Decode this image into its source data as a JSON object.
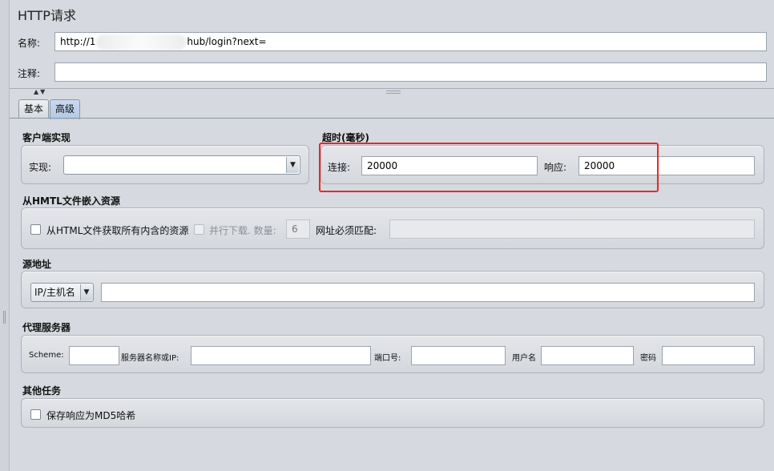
{
  "panel_title": "HTTP请求",
  "name_label": "名称:",
  "name_value_prefix": "http://1",
  "name_value_suffix": "hub/login?next=",
  "comment_label": "注释:",
  "comment_value": "",
  "tabs": [
    {
      "label": "基本",
      "active": false
    },
    {
      "label": "高级",
      "active": true
    }
  ],
  "client_impl": {
    "title": "客户端实现",
    "impl_label": "实现:",
    "impl_value": ""
  },
  "timeout": {
    "title": "超时(毫秒)",
    "connect_label": "连接:",
    "connect_value": "20000",
    "response_label": "响应:",
    "response_value": "20000"
  },
  "embedded": {
    "title": "从HMTL文件嵌入资源",
    "retrieve_label": "从HTML文件获取所有内含的资源",
    "retrieve_checked": false,
    "parallel_label": "并行下载. 数量:",
    "parallel_checked": false,
    "parallel_count": "6",
    "url_match_label": "网址必须匹配:",
    "url_match_value": ""
  },
  "source": {
    "title": "源地址",
    "type_value": "IP/主机名",
    "address_value": ""
  },
  "proxy": {
    "title": "代理服务器",
    "scheme_label": "Scheme:",
    "scheme_value": "",
    "server_label": "服务器名称或IP:",
    "server_value": "",
    "port_label": "端口号:",
    "port_value": "",
    "user_label": "用户名",
    "user_value": "",
    "password_label": "密码",
    "password_value": ""
  },
  "other": {
    "title": "其他任务",
    "md5_label": "保存响应为MD5哈希",
    "md5_checked": false
  },
  "colors": {
    "highlight": "#e52a2a",
    "background": "#d6d9df"
  }
}
